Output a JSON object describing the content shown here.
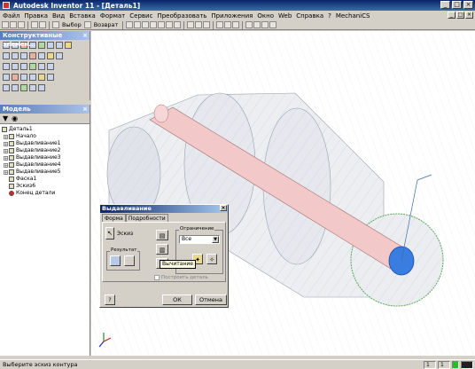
{
  "window": {
    "title": "Autodesk Inventor 11 - [Деталь1]",
    "controls": [
      "_",
      "□",
      "×"
    ]
  },
  "menu": {
    "items": [
      "Файл",
      "Правка",
      "Вид",
      "Вставка",
      "Формат",
      "Сервис",
      "Преобразовать",
      "Приложения",
      "Окно",
      "Web",
      "Справка",
      "?",
      "MechaniCS"
    ]
  },
  "toolbar": {
    "select_label": "Выбор",
    "return_label": "Возврат"
  },
  "panel1": {
    "title": "Конструктивные элемен...",
    "close": "×"
  },
  "model_panel": {
    "title": "Модель",
    "close": "×",
    "tree": [
      {
        "label": "Деталь1",
        "level": 0,
        "expander": ""
      },
      {
        "label": "Начало",
        "level": 1,
        "expander": "+"
      },
      {
        "label": "Выдавливание1",
        "level": 1,
        "expander": "+"
      },
      {
        "label": "Выдавливание2",
        "level": 1,
        "expander": "+"
      },
      {
        "label": "Выдавливание3",
        "level": 1,
        "expander": "+"
      },
      {
        "label": "Выдавливание4",
        "level": 1,
        "expander": "+"
      },
      {
        "label": "Выдавливание5",
        "level": 1,
        "expander": "+"
      },
      {
        "label": "Фаска1",
        "level": 1,
        "expander": ""
      },
      {
        "label": "Эскиз6",
        "level": 1,
        "expander": ""
      },
      {
        "label": "Конец детали",
        "level": 1,
        "expander": ""
      }
    ]
  },
  "dialog": {
    "title": "Выдавливание",
    "close": "×",
    "tabs": [
      "Форма",
      "Подробности"
    ],
    "sketch_label": "Эскиз",
    "result_label": "Результат",
    "limits_label": "Ограничение",
    "limits_value": "Все",
    "tooltip": "Вычитание",
    "checkbox_label": "Построить деталь",
    "ok_label": "ОК",
    "cancel_label": "Отмена",
    "help_label": "?"
  },
  "status": {
    "text": "Выберите эскиз контура",
    "field1": "1",
    "field2": "1"
  },
  "colors": {
    "accent": "#0a246a",
    "face_fill": "#3a7de0",
    "shaft_fill": "#f2c8c8"
  }
}
